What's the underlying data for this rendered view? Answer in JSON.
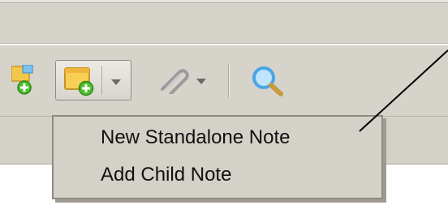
{
  "menu": {
    "items": [
      {
        "label": "New Standalone Note"
      },
      {
        "label": "Add Child Note"
      }
    ]
  },
  "icons": {
    "partial_left": "note-add-icon",
    "new_note": "sticky-note-add-icon",
    "attach": "paperclip-icon",
    "search": "magnifier-icon"
  },
  "colors": {
    "toolbar_bg": "#d6d3cb",
    "menu_bg": "#d4d1c9",
    "note_yellow": "#f6cf54",
    "add_green": "#4fbf2d",
    "search_blue": "#4aa6e6"
  }
}
